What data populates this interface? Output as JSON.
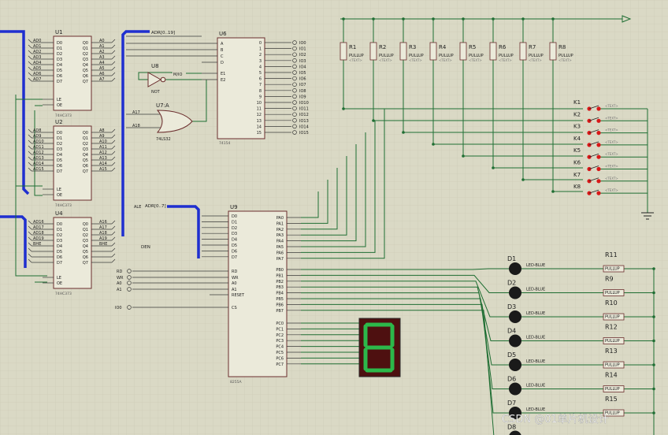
{
  "watermark": "CSDN @01单片机设计",
  "chips": {
    "u1": {
      "ref": "U1",
      "part": "74HC373"
    },
    "u2": {
      "ref": "U2",
      "part": "74HC373"
    },
    "u4": {
      "ref": "U4",
      "part": "74HC373"
    },
    "u6": {
      "ref": "U6",
      "part": "74154"
    },
    "u8": {
      "ref": "U8",
      "part": "NOT"
    },
    "u7a": {
      "ref": "U7:A",
      "part": "74LS32"
    },
    "u9": {
      "ref": "U9",
      "part": "8255A"
    }
  },
  "latch_pins": {
    "inputs": [
      "D0",
      "D1",
      "D2",
      "D3",
      "D4",
      "D5",
      "D6",
      "D7"
    ],
    "outputs": [
      "Q0",
      "Q1",
      "Q2",
      "Q3",
      "Q4",
      "Q5",
      "Q6",
      "Q7"
    ],
    "le": "LE",
    "oe": "OE"
  },
  "u1_labels": {
    "left": [
      "AD0",
      "AD1",
      "AD2",
      "AD3",
      "AD4",
      "AD5",
      "AD6",
      "AD7"
    ],
    "right": [
      "A0",
      "A1",
      "A2",
      "A3",
      "A4",
      "A5",
      "A6",
      "A7"
    ]
  },
  "u2_labels": {
    "left": [
      "AD8",
      "AD9",
      "AD10",
      "AD11",
      "AD12",
      "AD13",
      "AD14",
      "AD15"
    ],
    "right": [
      "A8",
      "A9",
      "A10",
      "A11",
      "A12",
      "A13",
      "A14",
      "A15"
    ]
  },
  "u4_labels": {
    "left": [
      "AD16",
      "AD17",
      "AD18",
      "AD19",
      "BHE",
      "",
      "",
      ""
    ],
    "right": [
      "A16",
      "A17",
      "A18",
      "A19",
      "BHE",
      "",
      "",
      ""
    ]
  },
  "bus_labels": {
    "adr": "ADR[0..19]",
    "adr_u9": "ADR[0..7]",
    "dt": "DT/R",
    "den": "DEN",
    "ale": "ALE",
    "mio": "M/IO",
    "rd": "RD",
    "wr": "WR",
    "a0": "A0",
    "a1": "A1"
  },
  "u6_labels": {
    "inputs": [
      "A",
      "B",
      "C",
      "D",
      "E1",
      "E2"
    ],
    "outputs": [
      "0",
      "1",
      "2",
      "3",
      "4",
      "5",
      "6",
      "7",
      "8",
      "9",
      "10",
      "11",
      "12",
      "13",
      "14",
      "15"
    ],
    "nets": [
      "IO0",
      "IO1",
      "IO2",
      "IO3",
      "IO4",
      "IO5",
      "IO6",
      "IO7",
      "IO8",
      "IO9",
      "IO10",
      "IO11",
      "IO12",
      "IO13",
      "IO14",
      "IO15"
    ]
  },
  "u9_labels": {
    "data": [
      "D0",
      "D1",
      "D2",
      "D3",
      "D4",
      "D5",
      "D6",
      "D7"
    ],
    "control": [
      "RD",
      "WR",
      "A0",
      "A1",
      "RESET",
      "CS"
    ],
    "pa": [
      "PA0",
      "PA1",
      "PA2",
      "PA3",
      "PA4",
      "PA5",
      "PA6",
      "PA7"
    ],
    "pb": [
      "PB0",
      "PB1",
      "PB2",
      "PB3",
      "PB4",
      "PB5",
      "PB6",
      "PB7"
    ],
    "pc": [
      "PC0",
      "PC1",
      "PC2",
      "PC3",
      "PC4",
      "PC5",
      "PC6",
      "PC7"
    ]
  },
  "pullups": [
    {
      "ref": "R1",
      "value": "PULLUP"
    },
    {
      "ref": "R2",
      "value": "PULLUP"
    },
    {
      "ref": "R3",
      "value": "PULLUP"
    },
    {
      "ref": "R4",
      "value": "PULLUP"
    },
    {
      "ref": "R5",
      "value": "PULLUP"
    },
    {
      "ref": "R6",
      "value": "PULLUP"
    },
    {
      "ref": "R7",
      "value": "PULLUP"
    },
    {
      "ref": "R8",
      "value": "PULLUP"
    }
  ],
  "switches": [
    "K1",
    "K2",
    "K3",
    "K4",
    "K5",
    "K6",
    "K7",
    "K8"
  ],
  "leds": [
    {
      "ref": "D1",
      "type": "LED-BLUE"
    },
    {
      "ref": "D2",
      "type": "LED-BLUE"
    },
    {
      "ref": "D3",
      "type": "LED-BLUE"
    },
    {
      "ref": "D4",
      "type": "LED-BLUE"
    },
    {
      "ref": "D5",
      "type": "LED-BLUE"
    },
    {
      "ref": "D6",
      "type": "LED-BLUE"
    },
    {
      "ref": "D7",
      "type": "LED-BLUE"
    },
    {
      "ref": "D8",
      "type": ""
    }
  ],
  "led_resistors": [
    {
      "ref": "R11",
      "value": "PULLUP"
    },
    {
      "ref": "R9",
      "value": "PULLUP"
    },
    {
      "ref": "R10",
      "value": "PULLUP"
    },
    {
      "ref": "R12",
      "value": "PULLUP"
    },
    {
      "ref": "R13",
      "value": "PULLUP"
    },
    {
      "ref": "R14",
      "value": "PULLUP"
    },
    {
      "ref": "R15",
      "value": "PULLUP"
    }
  ],
  "text_placeholder": "<TEXT>",
  "seven_seg_digit": "8",
  "colors": {
    "background": "#dad9c5",
    "wire": "#1f6e33",
    "bus": "#1f2fd0",
    "chip_fill": "#ebeada",
    "chip_stroke": "#6b2d2d",
    "pin_text": "#202020",
    "led_fill": "#1a1a1a",
    "seg_on": "#2cb84a",
    "seg_bg": "#4e1010",
    "switch_dot": "#d81818"
  }
}
